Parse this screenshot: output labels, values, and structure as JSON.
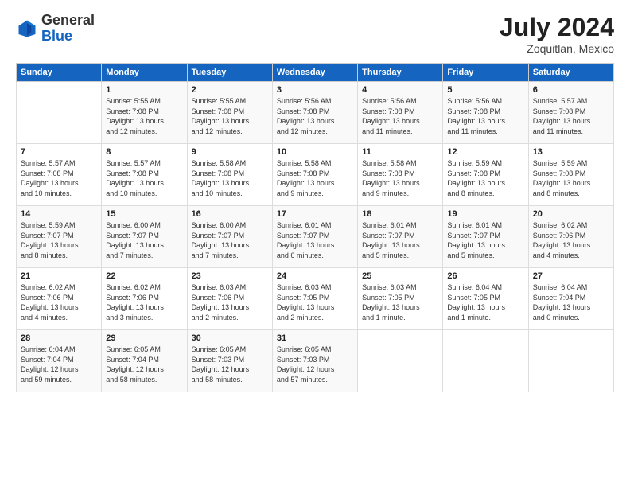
{
  "header": {
    "logo_general": "General",
    "logo_blue": "Blue",
    "title": "July 2024",
    "subtitle": "Zoquitlan, Mexico"
  },
  "columns": [
    "Sunday",
    "Monday",
    "Tuesday",
    "Wednesday",
    "Thursday",
    "Friday",
    "Saturday"
  ],
  "weeks": [
    [
      {
        "day": "",
        "info": ""
      },
      {
        "day": "1",
        "info": "Sunrise: 5:55 AM\nSunset: 7:08 PM\nDaylight: 13 hours\nand 12 minutes."
      },
      {
        "day": "2",
        "info": "Sunrise: 5:55 AM\nSunset: 7:08 PM\nDaylight: 13 hours\nand 12 minutes."
      },
      {
        "day": "3",
        "info": "Sunrise: 5:56 AM\nSunset: 7:08 PM\nDaylight: 13 hours\nand 12 minutes."
      },
      {
        "day": "4",
        "info": "Sunrise: 5:56 AM\nSunset: 7:08 PM\nDaylight: 13 hours\nand 11 minutes."
      },
      {
        "day": "5",
        "info": "Sunrise: 5:56 AM\nSunset: 7:08 PM\nDaylight: 13 hours\nand 11 minutes."
      },
      {
        "day": "6",
        "info": "Sunrise: 5:57 AM\nSunset: 7:08 PM\nDaylight: 13 hours\nand 11 minutes."
      }
    ],
    [
      {
        "day": "7",
        "info": "Sunrise: 5:57 AM\nSunset: 7:08 PM\nDaylight: 13 hours\nand 10 minutes."
      },
      {
        "day": "8",
        "info": "Sunrise: 5:57 AM\nSunset: 7:08 PM\nDaylight: 13 hours\nand 10 minutes."
      },
      {
        "day": "9",
        "info": "Sunrise: 5:58 AM\nSunset: 7:08 PM\nDaylight: 13 hours\nand 10 minutes."
      },
      {
        "day": "10",
        "info": "Sunrise: 5:58 AM\nSunset: 7:08 PM\nDaylight: 13 hours\nand 9 minutes."
      },
      {
        "day": "11",
        "info": "Sunrise: 5:58 AM\nSunset: 7:08 PM\nDaylight: 13 hours\nand 9 minutes."
      },
      {
        "day": "12",
        "info": "Sunrise: 5:59 AM\nSunset: 7:08 PM\nDaylight: 13 hours\nand 8 minutes."
      },
      {
        "day": "13",
        "info": "Sunrise: 5:59 AM\nSunset: 7:08 PM\nDaylight: 13 hours\nand 8 minutes."
      }
    ],
    [
      {
        "day": "14",
        "info": "Sunrise: 5:59 AM\nSunset: 7:07 PM\nDaylight: 13 hours\nand 8 minutes."
      },
      {
        "day": "15",
        "info": "Sunrise: 6:00 AM\nSunset: 7:07 PM\nDaylight: 13 hours\nand 7 minutes."
      },
      {
        "day": "16",
        "info": "Sunrise: 6:00 AM\nSunset: 7:07 PM\nDaylight: 13 hours\nand 7 minutes."
      },
      {
        "day": "17",
        "info": "Sunrise: 6:01 AM\nSunset: 7:07 PM\nDaylight: 13 hours\nand 6 minutes."
      },
      {
        "day": "18",
        "info": "Sunrise: 6:01 AM\nSunset: 7:07 PM\nDaylight: 13 hours\nand 5 minutes."
      },
      {
        "day": "19",
        "info": "Sunrise: 6:01 AM\nSunset: 7:07 PM\nDaylight: 13 hours\nand 5 minutes."
      },
      {
        "day": "20",
        "info": "Sunrise: 6:02 AM\nSunset: 7:06 PM\nDaylight: 13 hours\nand 4 minutes."
      }
    ],
    [
      {
        "day": "21",
        "info": "Sunrise: 6:02 AM\nSunset: 7:06 PM\nDaylight: 13 hours\nand 4 minutes."
      },
      {
        "day": "22",
        "info": "Sunrise: 6:02 AM\nSunset: 7:06 PM\nDaylight: 13 hours\nand 3 minutes."
      },
      {
        "day": "23",
        "info": "Sunrise: 6:03 AM\nSunset: 7:06 PM\nDaylight: 13 hours\nand 2 minutes."
      },
      {
        "day": "24",
        "info": "Sunrise: 6:03 AM\nSunset: 7:05 PM\nDaylight: 13 hours\nand 2 minutes."
      },
      {
        "day": "25",
        "info": "Sunrise: 6:03 AM\nSunset: 7:05 PM\nDaylight: 13 hours\nand 1 minute."
      },
      {
        "day": "26",
        "info": "Sunrise: 6:04 AM\nSunset: 7:05 PM\nDaylight: 13 hours\nand 1 minute."
      },
      {
        "day": "27",
        "info": "Sunrise: 6:04 AM\nSunset: 7:04 PM\nDaylight: 13 hours\nand 0 minutes."
      }
    ],
    [
      {
        "day": "28",
        "info": "Sunrise: 6:04 AM\nSunset: 7:04 PM\nDaylight: 12 hours\nand 59 minutes."
      },
      {
        "day": "29",
        "info": "Sunrise: 6:05 AM\nSunset: 7:04 PM\nDaylight: 12 hours\nand 58 minutes."
      },
      {
        "day": "30",
        "info": "Sunrise: 6:05 AM\nSunset: 7:03 PM\nDaylight: 12 hours\nand 58 minutes."
      },
      {
        "day": "31",
        "info": "Sunrise: 6:05 AM\nSunset: 7:03 PM\nDaylight: 12 hours\nand 57 minutes."
      },
      {
        "day": "",
        "info": ""
      },
      {
        "day": "",
        "info": ""
      },
      {
        "day": "",
        "info": ""
      }
    ]
  ]
}
